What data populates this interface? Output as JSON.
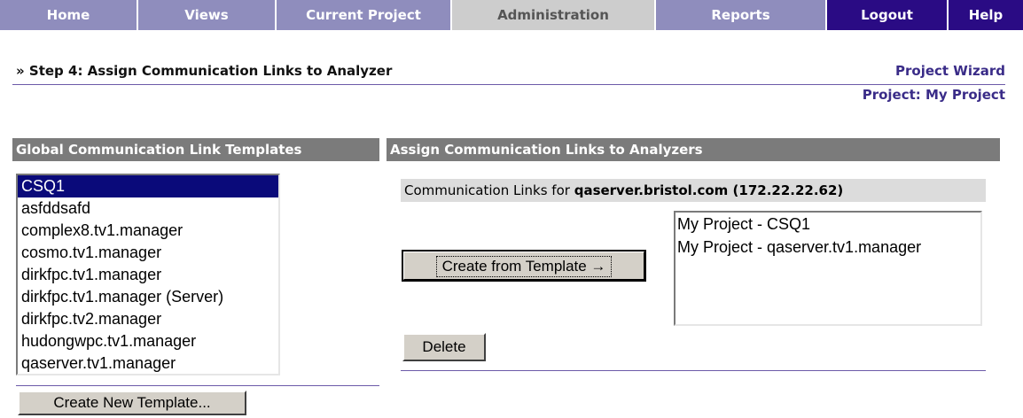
{
  "nav": {
    "items": [
      {
        "label": "Home"
      },
      {
        "label": "Views"
      },
      {
        "label": "Current Project"
      },
      {
        "label": "Administration"
      },
      {
        "label": "Reports"
      },
      {
        "label": "Logout"
      },
      {
        "label": "Help"
      }
    ],
    "active": "Administration"
  },
  "header": {
    "step_title": "» Step 4: Assign Communication Links to Analyzer",
    "wizard_link": "Project Wizard",
    "project_name": "Project: My Project"
  },
  "templates_panel": {
    "title": "Global Communication Link Templates",
    "items": [
      "CSQ1",
      "asfddsafd",
      "complex8.tv1.manager",
      "cosmo.tv1.manager",
      "dirkfpc.tv1.manager",
      "dirkfpc.tv1.manager (Server)",
      "dirkfpc.tv2.manager",
      "hudongwpc.tv1.manager",
      "qaserver.tv1.manager"
    ],
    "selected": "CSQ1",
    "create_button": "Create New Template..."
  },
  "assign_panel": {
    "title": "Assign Communication Links to Analyzers",
    "links_label": "Communication Links for ",
    "server": "qaserver.bristol.com (172.22.22.62)",
    "create_from_template_button": "Create from Template →",
    "assigned_links": [
      "My Project - CSQ1",
      "My Project - qaserver.tv1.manager"
    ],
    "delete_button": "Delete"
  },
  "colors": {
    "nav_bg": "#8f8dbd",
    "nav_active": "#cdcdcd",
    "nav_dark": "#2a0b84",
    "panel_header": "#7b7b7b",
    "selection": "#0a0a7a",
    "accent_text": "#3a2c88"
  }
}
